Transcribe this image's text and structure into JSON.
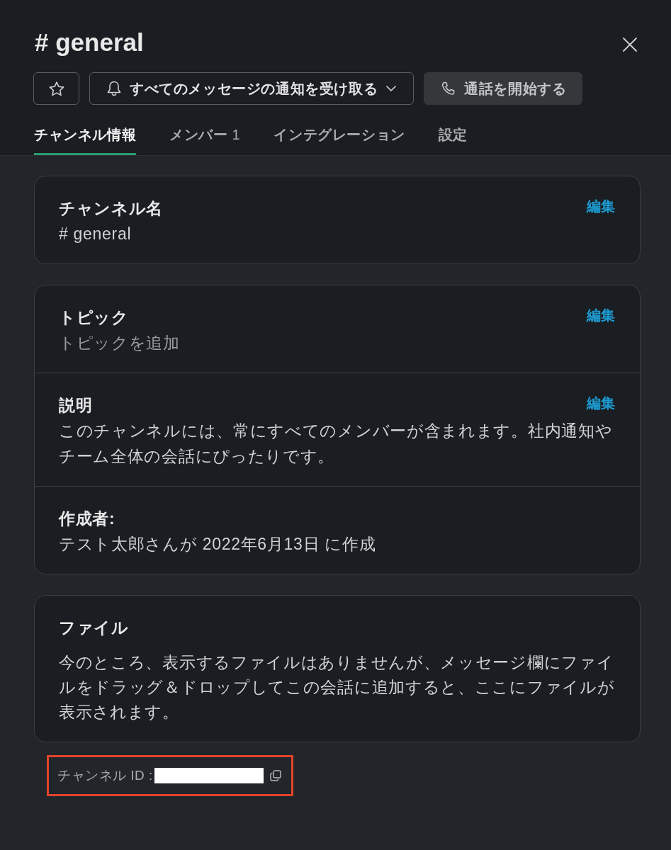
{
  "header": {
    "title": "# general"
  },
  "actions": {
    "notifications_button": {
      "label": "すべてのメッセージの通知を受け取る"
    },
    "call_button": {
      "label": "通話を開始する"
    }
  },
  "tabs": [
    {
      "label": "チャンネル情報",
      "selected": true
    },
    {
      "label": "メンバー",
      "count": "1",
      "selected": false
    },
    {
      "label": "インテグレーション",
      "selected": false
    },
    {
      "label": "設定",
      "selected": false
    }
  ],
  "cards": [
    {
      "sections": [
        {
          "kind": "field",
          "title": "チャンネル名",
          "value": "# general",
          "edit": "編集",
          "muted": false
        }
      ]
    },
    {
      "sections": [
        {
          "kind": "field",
          "title": "トピック",
          "value": "トピックを追加",
          "edit": "編集",
          "muted": true
        },
        {
          "kind": "field",
          "title": "説明",
          "value": "このチャンネルには、常にすべてのメンバーが含まれます。社内通知やチーム全体の会話にぴったりです。",
          "edit": "編集",
          "muted": false
        },
        {
          "kind": "field",
          "title": "作成者:",
          "value": "テスト太郎さんが 2022年6月13日 に作成",
          "muted": false
        }
      ]
    },
    {
      "sections": [
        {
          "kind": "paragraph",
          "title": "ファイル",
          "value": "今のところ、表示するファイルはありませんが、メッセージ欄にファイルをドラッグ＆ドロップしてこの会話に追加すると、ここにファイルが表示されます。",
          "muted": false
        }
      ]
    }
  ],
  "channel_id": {
    "label": "チャンネル ID :",
    "redacted": true,
    "highlighted": true
  }
}
